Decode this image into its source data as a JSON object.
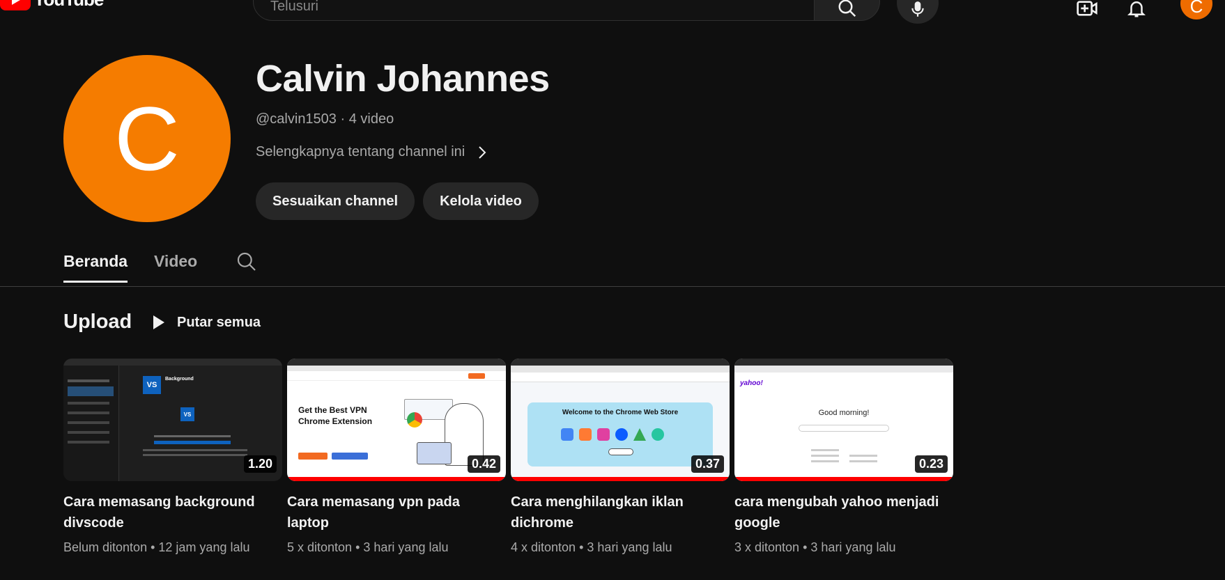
{
  "topbar": {
    "logo_text": "YouTube",
    "search_placeholder": "Telusuri",
    "avatar_letter": "C"
  },
  "channel": {
    "avatar_letter": "C",
    "name": "Calvin Johannes",
    "meta": "@calvin1503 · 4 video",
    "about": "Selengkapnya tentang channel ini",
    "buttons": {
      "customize": "Sesuaikan channel",
      "manage": "Kelola video"
    }
  },
  "tabs": [
    {
      "label": "Beranda",
      "active": true
    },
    {
      "label": "Video",
      "active": false
    }
  ],
  "section": {
    "title": "Upload",
    "play_all": "Putar semua"
  },
  "videos": [
    {
      "title": "Cara memasang background divscode",
      "duration": "1.20",
      "views": "Belum ditonton",
      "age": "12 jam yang lalu",
      "thumb_text": "Background",
      "watched_fraction": 0
    },
    {
      "title": "Cara memasang vpn pada laptop",
      "duration": "0.42",
      "views": "5 x ditonton",
      "age": "3 hari yang lalu",
      "thumb_text": "Get the Best VPN Chrome Extension",
      "watched_fraction": 1
    },
    {
      "title": "Cara menghilangkan iklan dichrome",
      "duration": "0.37",
      "views": "4 x ditonton",
      "age": "3 hari yang lalu",
      "thumb_text": "Welcome to the Chrome Web Store",
      "watched_fraction": 1
    },
    {
      "title": "cara mengubah yahoo menjadi google",
      "duration": "0.23",
      "views": "3 x ditonton",
      "age": "3 hari yang lalu",
      "thumb_text": "Good morning!",
      "thumb_brand": "yahoo!",
      "watched_fraction": 1
    }
  ],
  "colors": {
    "background": "#0f0f0f",
    "avatar": "#f57c00",
    "progress": "#ff0000",
    "button_bg": "#272727"
  }
}
